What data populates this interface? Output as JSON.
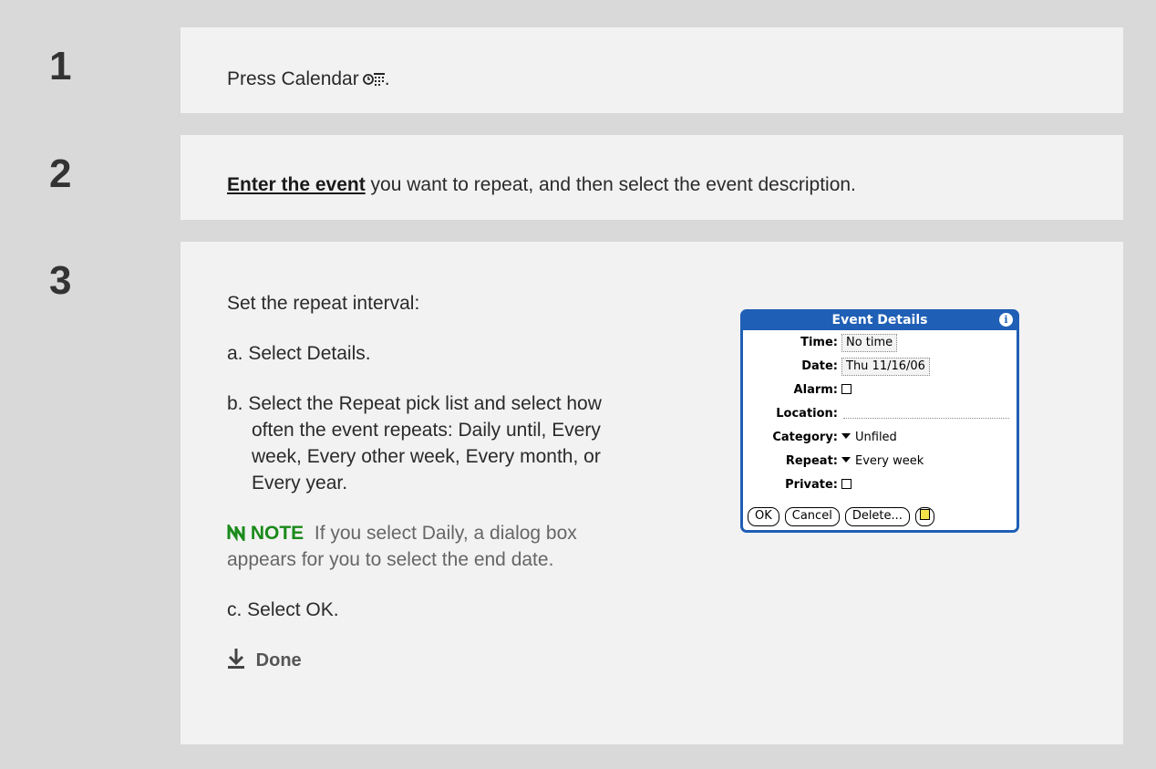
{
  "steps": [
    {
      "number": "1",
      "text_before": "Press Calendar",
      "text_after": "."
    },
    {
      "number": "2",
      "link": "Enter the event",
      "text": " you want to repeat, and then select the event description."
    },
    {
      "number": "3",
      "intro": "Set the repeat interval:",
      "a": "a.  Select Details.",
      "b_line1": "b.  Select the Repeat pick list and select how",
      "b_line2": "often the event repeats: Daily until, Every",
      "b_line3": "week, Every other week, Every month, or",
      "b_line4": "Every year.",
      "note_label": "NOTE",
      "note_line1": "If you select Daily, a dialog box",
      "note_line2": "appears for you to select the end date.",
      "c": "c.  Select OK.",
      "done": "Done"
    }
  ],
  "dialog": {
    "title": "Event Details",
    "time_label": "Time:",
    "time_value": "No time",
    "date_label": "Date:",
    "date_value": "Thu 11/16/06",
    "alarm_label": "Alarm:",
    "location_label": "Location:",
    "category_label": "Category:",
    "category_value": "Unfiled",
    "repeat_label": "Repeat:",
    "repeat_value": "Every week",
    "private_label": "Private:",
    "ok": "OK",
    "cancel": "Cancel",
    "delete": "Delete..."
  },
  "colors": {
    "note_green": "#1a8a1a",
    "dialog_blue": "#1f5fb5",
    "page_gray": "#d9d9d9",
    "panel": "#f2f2f2"
  }
}
